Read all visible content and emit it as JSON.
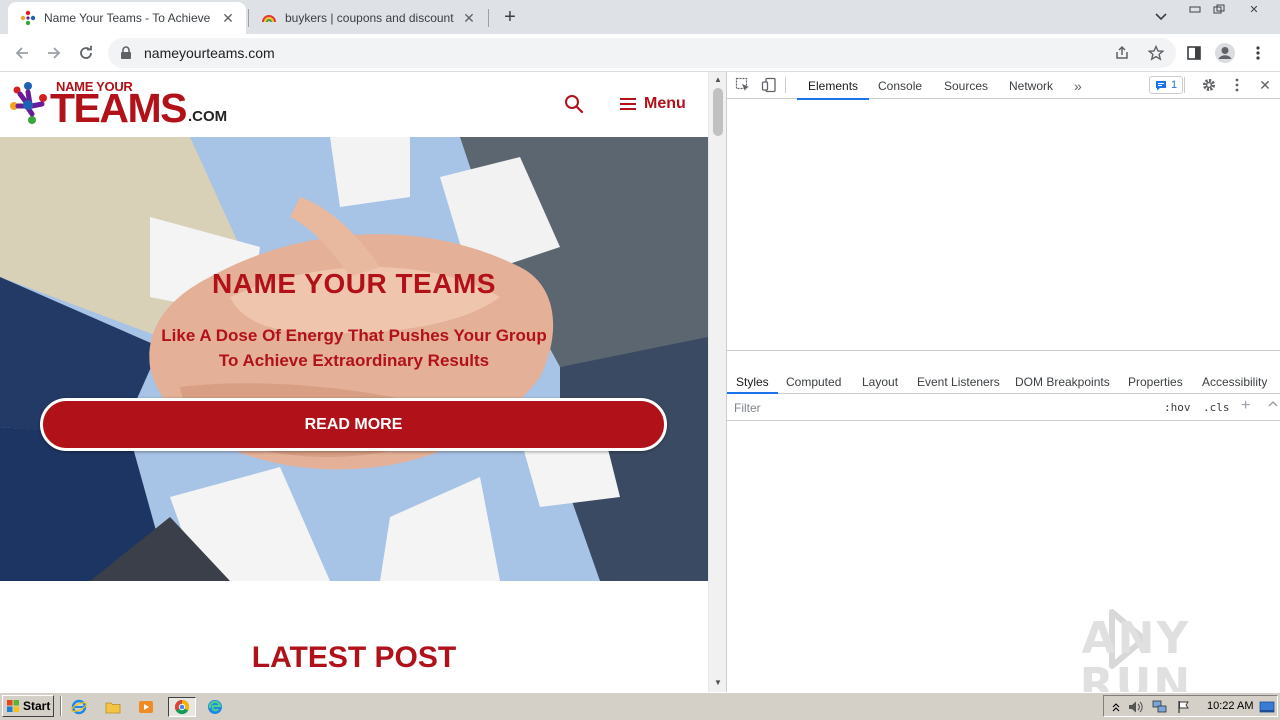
{
  "browser": {
    "tabs": [
      {
        "title": "Name Your Teams - To Achieve Extraordinary Results",
        "active": true
      },
      {
        "title": "buykers | coupons and discount codes",
        "active": false
      }
    ],
    "address": "nameyourteams.com"
  },
  "site": {
    "logo_top": "NAME YOUR",
    "logo_main": "TEAMS",
    "logo_suffix": ".COM",
    "menu_label": "Menu",
    "hero": {
      "title": "NAME YOUR TEAMS",
      "subtitle_line1": "Like A Dose Of Energy That Pushes Your Group",
      "subtitle_line2": "To Achieve Extraordinary Results",
      "cta": "READ MORE"
    },
    "latest_post": "LATEST POST"
  },
  "devtools": {
    "tabs": [
      "Elements",
      "Console",
      "Sources",
      "Network"
    ],
    "active_tab": "Elements",
    "issues_count": "1",
    "subtabs": [
      "Styles",
      "Computed",
      "Layout",
      "Event Listeners",
      "DOM Breakpoints",
      "Properties",
      "Accessibility"
    ],
    "active_subtab": "Styles",
    "filter_placeholder": "Filter",
    "hov": ":hov",
    "cls": ".cls"
  },
  "watermark": "ANY RUN",
  "taskbar": {
    "start": "Start",
    "clock": "10:22 AM"
  },
  "colors": {
    "brand_red": "#b1121a",
    "devtools_accent": "#1a73e8",
    "taskbar": "#d4d0c8"
  }
}
